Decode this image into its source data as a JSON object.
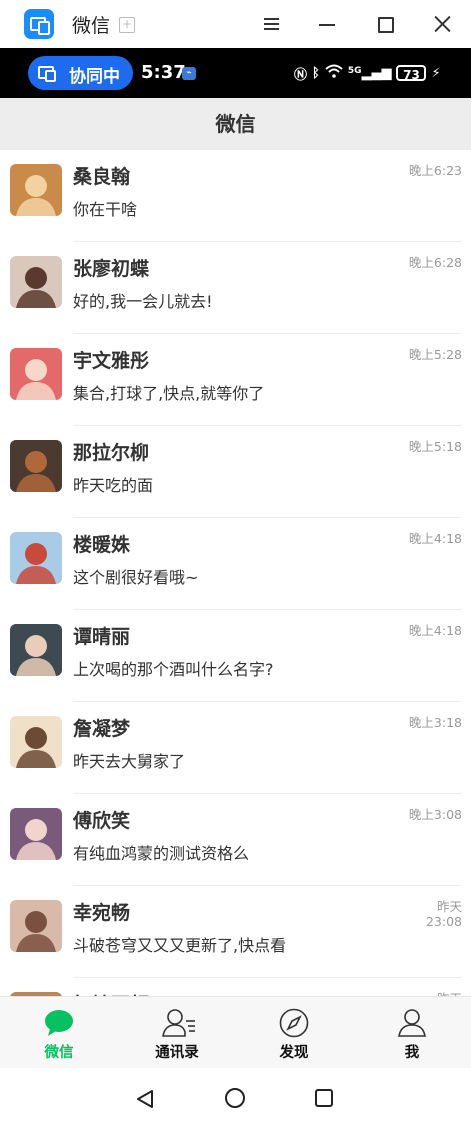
{
  "window": {
    "title": "微信",
    "icon": "collab-app-icon"
  },
  "statusbar": {
    "collab_label": "协同中",
    "time": "5:37",
    "signal_text": "5G",
    "battery": "73"
  },
  "header": {
    "title": "微信"
  },
  "chats": [
    {
      "name": "桑良翰",
      "message": "你在干啥",
      "time": "晚上6:23",
      "avatar_color": "#c98a4a",
      "avatar_accent": "#f3d2a2"
    },
    {
      "name": "张廖初蝶",
      "message": "好的,我一会儿就去!",
      "time": "晚上6:28",
      "avatar_color": "#d9c8bb",
      "avatar_accent": "#5a3a2e"
    },
    {
      "name": "宇文雅彤",
      "message": "集合,打球了,快点,就等你了",
      "time": "晚上5:28",
      "avatar_color": "#e46a6a",
      "avatar_accent": "#f7d7c8"
    },
    {
      "name": "那拉尔柳",
      "message": "昨天吃的面",
      "time": "晚上5:18",
      "avatar_color": "#4a3a30",
      "avatar_accent": "#b0683a"
    },
    {
      "name": "楼暖姝",
      "message": "这个剧很好看哦~",
      "time": "晚上4:18",
      "avatar_color": "#a8cce8",
      "avatar_accent": "#c74a3a"
    },
    {
      "name": "谭晴丽",
      "message": "上次喝的那个酒叫什么名字?",
      "time": "晚上4:18",
      "avatar_color": "#3e4a52",
      "avatar_accent": "#e9cdb8"
    },
    {
      "name": "詹凝梦",
      "message": "昨天去大舅家了",
      "time": "晚上3:18",
      "avatar_color": "#f1e0c8",
      "avatar_accent": "#6b4a36"
    },
    {
      "name": "傅欣笑",
      "message": "有纯血鸿蒙的测试资格么",
      "time": "晚上3:08",
      "avatar_color": "#7a5a7a",
      "avatar_accent": "#f3d4cc"
    },
    {
      "name": "幸宛畅",
      "message": "斗破苍穹又又又更新了,快点看",
      "time": "昨天\n23:08",
      "avatar_color": "#d9b9a8",
      "avatar_accent": "#7a5040"
    },
    {
      "name": "打娃百顿",
      "message": "",
      "time": "昨天",
      "avatar_color": "#b58a5a",
      "avatar_accent": "#e8c89a"
    }
  ],
  "tabs": [
    {
      "label": "微信",
      "icon": "chat-bubble-icon",
      "active": true
    },
    {
      "label": "通讯录",
      "icon": "contacts-icon",
      "active": false
    },
    {
      "label": "发现",
      "icon": "compass-icon",
      "active": false
    },
    {
      "label": "我",
      "icon": "person-icon",
      "active": false
    }
  ],
  "colors": {
    "accent": "#07c160",
    "header_bg": "#ededed",
    "collab_blue": "#1d6cf0"
  }
}
